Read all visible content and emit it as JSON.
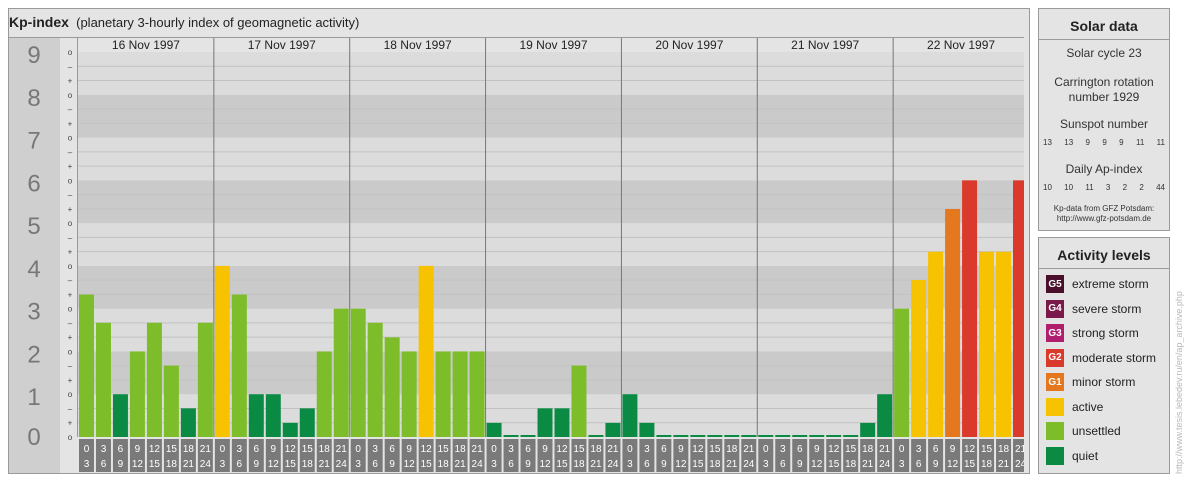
{
  "chart_data": {
    "type": "bar",
    "title": "Kp-index",
    "subtitle": "(planetary 3-hourly index of geomagnetic activity)",
    "ylim": [
      0,
      9
    ],
    "y_ticks": [
      "0",
      "1",
      "2",
      "3",
      "4",
      "5",
      "6",
      "7",
      "8",
      "9"
    ],
    "minor_tick_labels": [
      "+",
      "o",
      "–"
    ],
    "days": [
      "16 Nov 1997",
      "17 Nov 1997",
      "18 Nov 1997",
      "19 Nov 1997",
      "20 Nov 1997",
      "21 Nov 1997",
      "22 Nov 1997"
    ],
    "slot_labels": [
      [
        "0",
        "3"
      ],
      [
        "3",
        "6"
      ],
      [
        "6",
        "9"
      ],
      [
        "9",
        "12"
      ],
      [
        "12",
        "15"
      ],
      [
        "15",
        "18"
      ],
      [
        "18",
        "21"
      ],
      [
        "21",
        "24"
      ]
    ],
    "values": [
      [
        3.33,
        2.67,
        1.0,
        2.0,
        2.67,
        1.67,
        0.67,
        2.67
      ],
      [
        4.0,
        3.33,
        1.0,
        1.0,
        0.33,
        0.67,
        2.0,
        3.0
      ],
      [
        3.0,
        2.67,
        2.33,
        2.0,
        4.0,
        2.0,
        2.0,
        2.0
      ],
      [
        0.33,
        -0.33,
        0.0,
        0.67,
        0.67,
        1.67,
        0.0,
        0.33
      ],
      [
        1.0,
        0.33,
        0.0,
        -0.33,
        -0.33,
        0.0,
        0.0,
        0.0
      ],
      [
        0.0,
        -0.33,
        -0.33,
        -0.33,
        -0.33,
        0.0,
        0.33,
        1.0
      ],
      [
        3.0,
        3.67,
        4.33,
        5.33,
        6.0,
        4.33,
        4.33,
        6.0
      ]
    ],
    "grid": true
  },
  "solar": {
    "title": "Solar data",
    "cycle": "Solar cycle 23",
    "carrington_line1": "Carrington rotation",
    "carrington_line2": "number 1929",
    "sunspot_label": "Sunspot number",
    "sunspot_values": [
      "13",
      "13",
      "9",
      "9",
      "9",
      "11",
      "11"
    ],
    "ap_label": "Daily Ap-index",
    "ap_values": [
      "10",
      "10",
      "11",
      "3",
      "2",
      "2",
      "44"
    ],
    "credit_line1": "Kp-data from GFZ Potsdam:",
    "credit_line2": "http://www.gfz-potsdam.de"
  },
  "activity": {
    "title": "Activity levels",
    "items": [
      {
        "code": "G5",
        "label": "extreme storm",
        "color": "#4a0f2a"
      },
      {
        "code": "G4",
        "label": "severe storm",
        "color": "#7a1a4a"
      },
      {
        "code": "G3",
        "label": "strong storm",
        "color": "#b01e6e"
      },
      {
        "code": "G2",
        "label": "moderate storm",
        "color": "#d93a2b"
      },
      {
        "code": "G1",
        "label": "minor storm",
        "color": "#e5771e"
      },
      {
        "code": "",
        "label": "active",
        "color": "#f7c200"
      },
      {
        "code": "",
        "label": "unsettled",
        "color": "#7dbd2a"
      },
      {
        "code": "",
        "label": "quiet",
        "color": "#0a8a43"
      }
    ]
  },
  "watermark": "http://www.tesis.lebedev.ru/en/ap_archive.php"
}
